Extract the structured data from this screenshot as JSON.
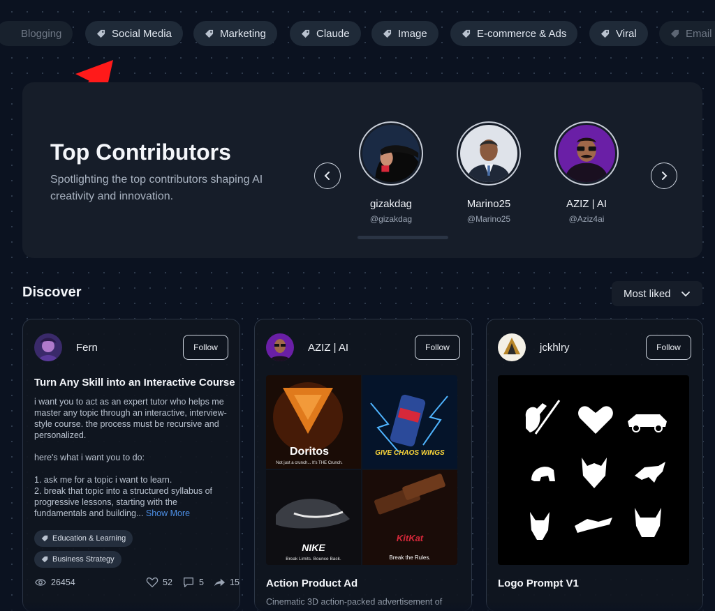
{
  "tags": [
    {
      "label": "Blogging"
    },
    {
      "label": "Social Media"
    },
    {
      "label": "Marketing"
    },
    {
      "label": "Claude"
    },
    {
      "label": "Image"
    },
    {
      "label": "E-commerce & Ads"
    },
    {
      "label": "Viral"
    },
    {
      "label": "Email"
    }
  ],
  "contributors_section": {
    "title": "Top Contributors",
    "subtitle": "Spotlighting the top contributors shaping AI creativity and innovation.",
    "contributors": [
      {
        "name": "gizakdag",
        "handle": "@gizakdag"
      },
      {
        "name": "Marino25",
        "handle": "@Marino25"
      },
      {
        "name": "AZIZ | AI",
        "handle": "@Aziz4ai"
      }
    ]
  },
  "discover": {
    "title": "Discover",
    "sort_label": "Most liked"
  },
  "cards": [
    {
      "author": "Fern",
      "follow_label": "Follow",
      "title": "Turn Any Skill into an Interactive Course",
      "body": "i want you to act as an expert tutor who helps me master any topic through an interactive, interview-style course. the process must be recursive and personalized.\n\nhere's what i want you to do:\n\n1. ask me for a topic i want to learn.\n2. break that topic into a structured syllabus of progressive lessons, starting with the fundamentals and building...",
      "show_more": "Show More",
      "tags": [
        "Education & Learning",
        "Business Strategy"
      ],
      "views": "26454",
      "likes": "52",
      "comments": "5",
      "shares": "15"
    },
    {
      "author": "AZIZ | AI",
      "follow_label": "Follow",
      "title": "Action Product Ad",
      "description": "Cinematic 3D action-packed advertisement of",
      "image_texts": {
        "doritos": "Doritos",
        "doritos_tag": "Not just a crunch... It's THE Crunch.",
        "redbull": "GIVE CHAOS WINGS",
        "nike": "NIKE",
        "nike_tag": "Break Limits. Bounce Back.",
        "kitkat": "KitKat",
        "kitkat_tag": "Break the Rules."
      }
    },
    {
      "author": "jckhlry",
      "follow_label": "Follow",
      "title": "Logo Prompt V1"
    }
  ],
  "colors": {
    "background": "#0b1220",
    "panel": "#161d29",
    "tag_bg": "#1f2a38",
    "link": "#4d8fe6",
    "arrow": "#ff1a1a"
  }
}
